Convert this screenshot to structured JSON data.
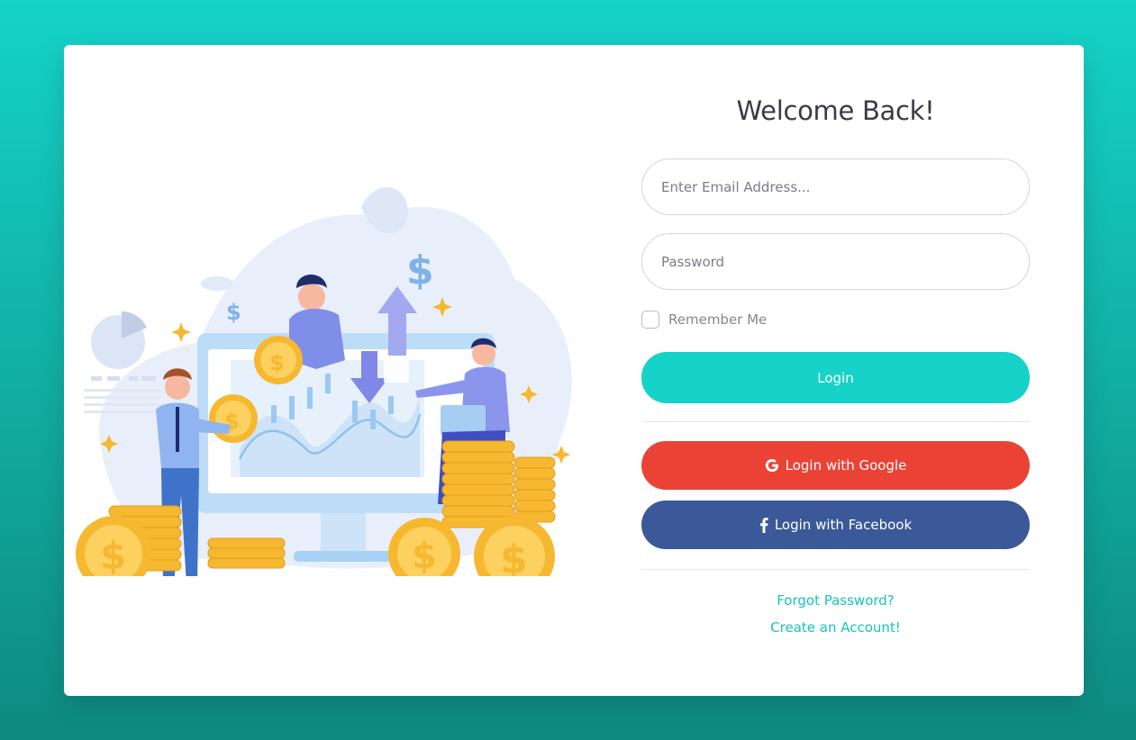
{
  "form": {
    "title": "Welcome Back!",
    "email": {
      "placeholder": "Enter Email Address...",
      "value": ""
    },
    "password": {
      "placeholder": "Password",
      "value": ""
    },
    "remember": {
      "label": "Remember Me",
      "checked": false
    },
    "login_label": "Login",
    "google_label": "Login with Google",
    "facebook_label": "Login with Facebook",
    "forgot_label": "Forgot Password?",
    "create_label": "Create an Account!"
  },
  "colors": {
    "background": "#15d3c8",
    "accent": "#17d2c8",
    "google": "#ea4335",
    "facebook": "#3b5998",
    "link": "#17c4ba"
  },
  "icons": {
    "google": "google-icon",
    "facebook": "facebook-icon",
    "illustration": "finance-team-illustration"
  }
}
